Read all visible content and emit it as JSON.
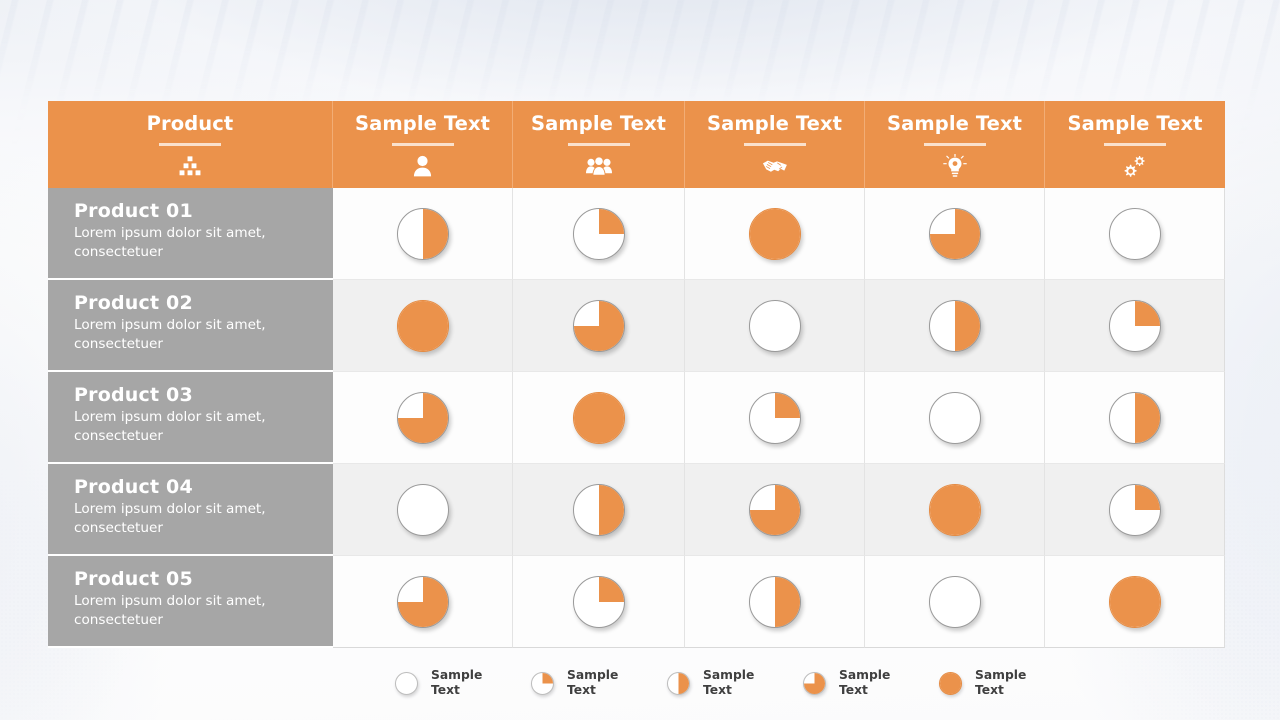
{
  "theme": {
    "accent": "#eb924b",
    "label_bg": "#a6a6a6",
    "row_odd_bg": "#fdfdfd",
    "row_even_bg": "#f0f0f0",
    "header_text": "#ffffff",
    "legend_text": "#3f3f3f"
  },
  "table": {
    "columns": [
      {
        "label": "Product",
        "icon": "boxes-stack-icon"
      },
      {
        "label": "Sample Text",
        "icon": "person-icon"
      },
      {
        "label": "Sample Text",
        "icon": "group-people-icon"
      },
      {
        "label": "Sample Text",
        "icon": "handshake-icon"
      },
      {
        "label": "Sample Text",
        "icon": "lightbulb-idea-icon"
      },
      {
        "label": "Sample Text",
        "icon": "gears-icon"
      }
    ],
    "rows": [
      {
        "title": "Product  01",
        "desc": "Lorem ipsum dolor sit amet, consectetuer",
        "values": [
          50,
          25,
          100,
          75,
          0
        ]
      },
      {
        "title": "Product  02",
        "desc": "Lorem ipsum dolor sit amet, consectetuer",
        "values": [
          100,
          75,
          0,
          50,
          25
        ]
      },
      {
        "title": "Product  03",
        "desc": "Lorem ipsum dolor sit amet, consectetuer",
        "values": [
          75,
          100,
          25,
          0,
          50
        ]
      },
      {
        "title": "Product  04",
        "desc": "Lorem ipsum dolor sit amet, consectetuer",
        "values": [
          0,
          50,
          75,
          100,
          25
        ]
      },
      {
        "title": "Product  05",
        "desc": "Lorem ipsum dolor sit amet, consectetuer",
        "values": [
          75,
          25,
          50,
          0,
          100
        ]
      }
    ]
  },
  "legend": {
    "items": [
      {
        "value": 0,
        "label": "Sample\nText"
      },
      {
        "value": 25,
        "label": "Sample\nText"
      },
      {
        "value": 50,
        "label": "Sample\nText"
      },
      {
        "value": 75,
        "label": "Sample\nText"
      },
      {
        "value": 100,
        "label": "Sample\nText"
      }
    ]
  },
  "chart_data": {
    "type": "heatmap",
    "title": "Product comparison matrix",
    "categories": [
      "Sample Text",
      "Sample Text",
      "Sample Text",
      "Sample Text",
      "Sample Text"
    ],
    "series": [
      {
        "name": "Product  01",
        "values": [
          50,
          25,
          100,
          75,
          0
        ]
      },
      {
        "name": "Product  02",
        "values": [
          100,
          75,
          0,
          50,
          25
        ]
      },
      {
        "name": "Product  03",
        "values": [
          75,
          100,
          25,
          0,
          50
        ]
      },
      {
        "name": "Product  04",
        "values": [
          0,
          50,
          75,
          100,
          25
        ]
      },
      {
        "name": "Product  05",
        "values": [
          75,
          25,
          50,
          0,
          100
        ]
      }
    ],
    "value_scale": [
      0,
      25,
      50,
      75,
      100
    ],
    "marker": "pie-fill-percent",
    "legend_position": "bottom",
    "grid": true,
    "xlabel": "",
    "ylabel": ""
  }
}
